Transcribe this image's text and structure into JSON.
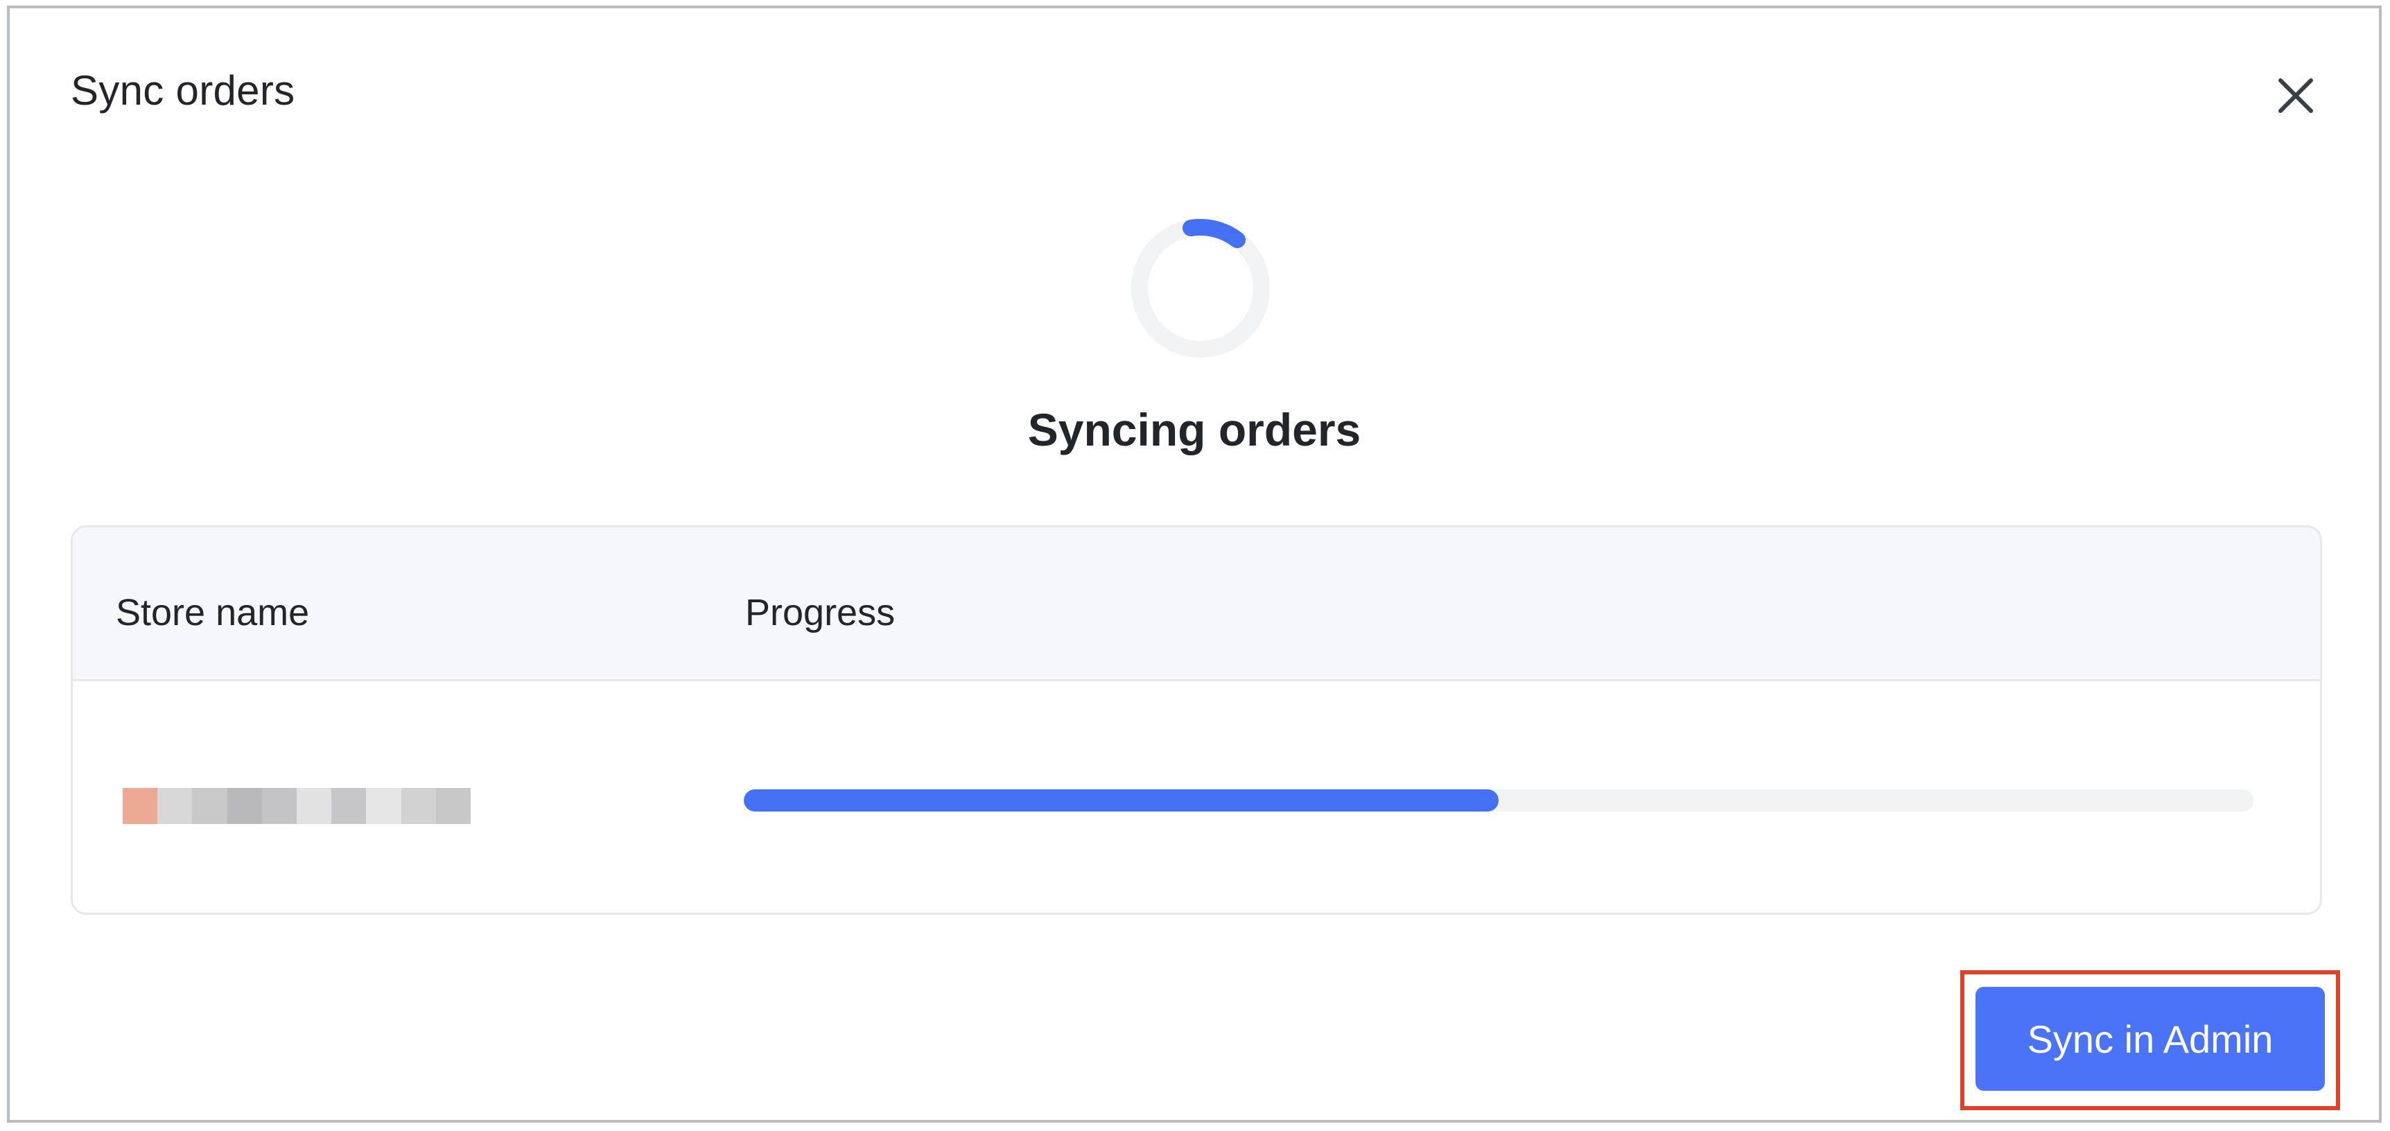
{
  "dialog": {
    "title": "Sync orders",
    "close_icon": "close-icon"
  },
  "status": {
    "spinner_icon": "loading-spinner-icon",
    "label": "Syncing orders"
  },
  "table": {
    "columns": [
      "Store name",
      "Progress"
    ],
    "rows": [
      {
        "store_name_obscured": true,
        "progress_fraction": 0.5
      }
    ]
  },
  "footer": {
    "primary_button": "Sync in Admin"
  },
  "colors": {
    "accent": "#4470f4",
    "highlight": "#e0412b",
    "text": "#22252b",
    "header_bg": "#f6f7fa"
  }
}
